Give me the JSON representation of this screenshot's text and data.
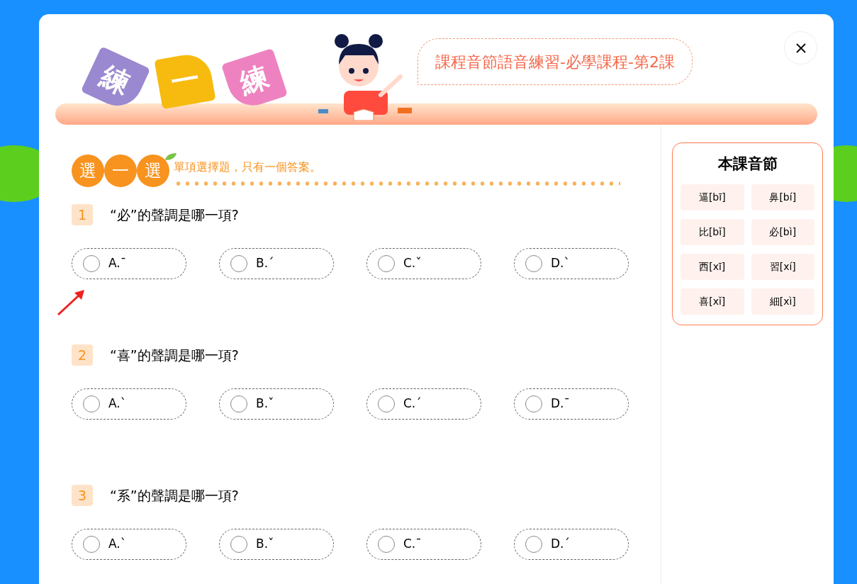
{
  "banner": {
    "title_tiles": [
      {
        "text": "練",
        "color": "#9a88d0"
      },
      {
        "text": "一",
        "color": "#f6bb0e"
      },
      {
        "text": "練",
        "color": "#ee82c0"
      }
    ],
    "lesson_title": "課程音節語音練習-必學課程-第2課"
  },
  "section": {
    "badge_chars": [
      "選",
      "一",
      "選"
    ],
    "instruction": "單項選擇題，只有一個答案。"
  },
  "questions": [
    {
      "number": "1",
      "prompt": "“必”的聲調是哪一項?",
      "options": [
        {
          "label": "A.ˉ",
          "selected": false
        },
        {
          "label": "B.ˊ",
          "selected": false
        },
        {
          "label": "C.ˇ",
          "selected": false
        },
        {
          "label": "D.ˋ",
          "selected": false
        }
      ]
    },
    {
      "number": "2",
      "prompt": "“喜”的聲調是哪一項?",
      "options": [
        {
          "label": "A.ˋ",
          "selected": false
        },
        {
          "label": "B.ˇ",
          "selected": false
        },
        {
          "label": "C.ˊ",
          "selected": false
        },
        {
          "label": "D.ˉ",
          "selected": false
        }
      ]
    },
    {
      "number": "3",
      "prompt": "“系”的聲調是哪一項?",
      "options": [
        {
          "label": "A.ˋ",
          "selected": false
        },
        {
          "label": "B.ˇ",
          "selected": false
        },
        {
          "label": "C.ˉ",
          "selected": false
        },
        {
          "label": "D.ˊ",
          "selected": false
        }
      ]
    }
  ],
  "syllables_panel": {
    "title": "本課音節",
    "items": [
      "逼[bī]",
      "鼻[bí]",
      "比[bǐ]",
      "必[bì]",
      "西[xī]",
      "習[xí]",
      "喜[xǐ]",
      "細[xì]"
    ]
  }
}
